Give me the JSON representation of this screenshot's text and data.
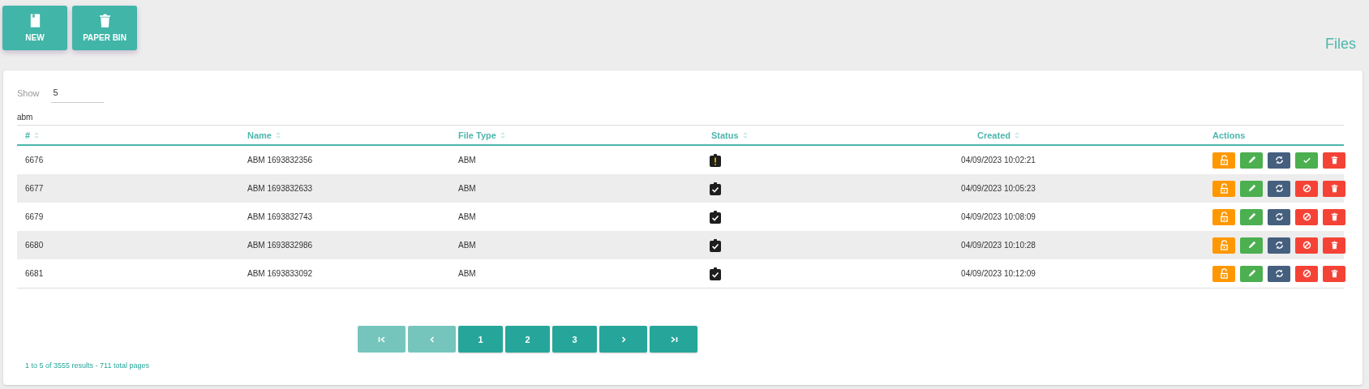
{
  "toolbar": [
    {
      "kind": "new",
      "label": "NEW"
    },
    {
      "kind": "bin",
      "label": "PAPER BIN"
    }
  ],
  "page_title": "Files",
  "show": {
    "label": "Show",
    "value": "5"
  },
  "filter": "abm",
  "table": {
    "columns": [
      {
        "label": "#",
        "sortable": true
      },
      {
        "label": "Name",
        "sortable": true
      },
      {
        "label": "File Type",
        "sortable": true
      },
      {
        "label": "Status",
        "sortable": true
      },
      {
        "label": "Created",
        "sortable": true
      },
      {
        "label": "Actions",
        "sortable": false
      }
    ],
    "rows": [
      {
        "id": "6676",
        "name": "ABM 1693832356",
        "file_type": "ABM",
        "status": {
          "kind": "warning"
        },
        "created": "04/09/2023 10:02:21",
        "actions": [
          {
            "kind": "unlock"
          },
          {
            "kind": "edit"
          },
          {
            "kind": "sync"
          },
          {
            "kind": "approve"
          },
          {
            "kind": "delete"
          }
        ]
      },
      {
        "id": "6677",
        "name": "ABM 1693832633",
        "file_type": "ABM",
        "status": {
          "kind": "done"
        },
        "created": "04/09/2023 10:05:23",
        "actions": [
          {
            "kind": "unlock"
          },
          {
            "kind": "edit"
          },
          {
            "kind": "sync"
          },
          {
            "kind": "block"
          },
          {
            "kind": "delete"
          }
        ]
      },
      {
        "id": "6679",
        "name": "ABM 1693832743",
        "file_type": "ABM",
        "status": {
          "kind": "done"
        },
        "created": "04/09/2023 10:08:09",
        "actions": [
          {
            "kind": "unlock"
          },
          {
            "kind": "edit"
          },
          {
            "kind": "sync"
          },
          {
            "kind": "block"
          },
          {
            "kind": "delete"
          }
        ]
      },
      {
        "id": "6680",
        "name": "ABM 1693832986",
        "file_type": "ABM",
        "status": {
          "kind": "done"
        },
        "created": "04/09/2023 10:10:28",
        "actions": [
          {
            "kind": "unlock"
          },
          {
            "kind": "edit"
          },
          {
            "kind": "sync"
          },
          {
            "kind": "block"
          },
          {
            "kind": "delete"
          }
        ]
      },
      {
        "id": "6681",
        "name": "ABM 1693833092",
        "file_type": "ABM",
        "status": {
          "kind": "done"
        },
        "created": "04/09/2023 10:12:09",
        "actions": [
          {
            "kind": "unlock"
          },
          {
            "kind": "edit"
          },
          {
            "kind": "sync"
          },
          {
            "kind": "block"
          },
          {
            "kind": "delete"
          }
        ]
      }
    ]
  },
  "pagination": [
    {
      "kind": "first",
      "disabled": true
    },
    {
      "kind": "prev",
      "disabled": true
    },
    {
      "kind": "page",
      "label": "1",
      "disabled": false
    },
    {
      "kind": "page",
      "label": "2",
      "disabled": false
    },
    {
      "kind": "page",
      "label": "3",
      "disabled": false
    },
    {
      "kind": "next",
      "disabled": false
    },
    {
      "kind": "last",
      "disabled": false
    }
  ],
  "summary": "1 to 5 of 3555 results - 711 total pages"
}
